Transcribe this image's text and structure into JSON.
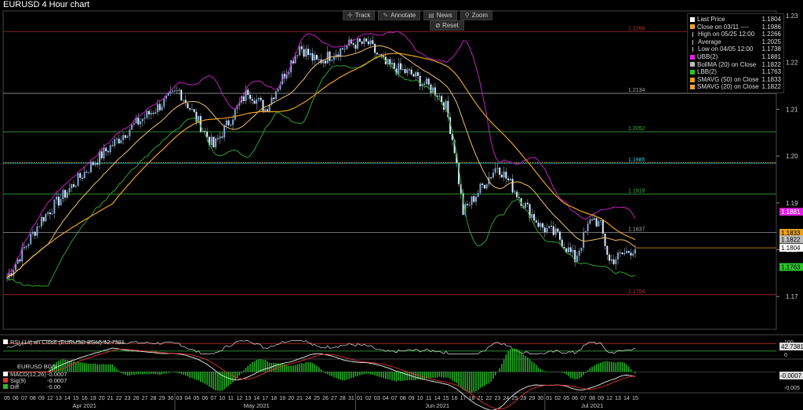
{
  "title": "EURUSD 4 Hour chart",
  "toolbar": {
    "track_label": "Track",
    "annotate_label": "Annotate",
    "news_label": "News",
    "zoom_label": "Zoom",
    "reset_label": "Reset"
  },
  "legend": [
    {
      "label": "Last Price",
      "value": "1.1804",
      "color": "#ffffff",
      "icon": "square"
    },
    {
      "label": "Close on 03/11 ----",
      "value": "1.1986",
      "color": "#f0a030",
      "icon": "square"
    },
    {
      "label": "High on 05/25 12:00",
      "value": "1.2266",
      "color": "#cccccc",
      "icon": "high-marker"
    },
    {
      "label": "Average",
      "value": "1.2025",
      "color": "#cccccc",
      "icon": "average-marker"
    },
    {
      "label": "Low on 04/05 12:00",
      "value": "1.1738",
      "color": "#cccccc",
      "icon": "low-marker"
    },
    {
      "label": "UBB(2)",
      "value": "1.1881",
      "color": "#e020e0",
      "icon": "square"
    },
    {
      "label": "BollMA (20)  on Close",
      "value": "1.1822",
      "color": "#bbbbbb",
      "icon": "square"
    },
    {
      "label": "LBB(2)",
      "value": "1.1763",
      "color": "#30c030",
      "icon": "square"
    },
    {
      "label": "SMAVG (50)  on Close",
      "value": "1.1833",
      "color": "#e8a020",
      "icon": "square"
    },
    {
      "label": "SMAVG (20)  on Close",
      "value": "1.1822",
      "color": "#f0a040",
      "icon": "square"
    }
  ],
  "chart_data": {
    "type": "line",
    "symbol": "EURUSD",
    "timeframe": "4 Hour",
    "ylim": [
      1.163,
      1.231
    ],
    "y_ticks": [
      "1.23",
      "1.22",
      "1.21",
      "1.20",
      "1.19",
      "1.18",
      "1.17"
    ],
    "y_tick_values": [
      1.23,
      1.22,
      1.21,
      1.2,
      1.19,
      1.18,
      1.17
    ],
    "x_day_labels": [
      "05",
      "06",
      "07",
      "08",
      "09",
      "12",
      "13",
      "14",
      "15",
      "16",
      "19",
      "20",
      "21",
      "22",
      "23",
      "26",
      "27",
      "28",
      "29",
      "30",
      "03",
      "04",
      "05",
      "06",
      "07",
      "10",
      "11",
      "12",
      "13",
      "14",
      "17",
      "18",
      "19",
      "20",
      "21",
      "24",
      "25",
      "26",
      "27",
      "28",
      "31",
      "01",
      "02",
      "03",
      "04",
      "07",
      "08",
      "09",
      "10",
      "11",
      "14",
      "15",
      "16",
      "17",
      "18",
      "21",
      "22",
      "23",
      "24",
      "25",
      "28",
      "29",
      "30",
      "01",
      "02",
      "05",
      "06",
      "07",
      "08",
      "09",
      "12",
      "13",
      "14",
      "15"
    ],
    "x_month_labels": [
      "Apr 2021",
      "May 2021",
      "Jun 2021",
      "Jul 2021"
    ],
    "horizontal_levels": [
      {
        "label": "1.2266",
        "value": 1.2266,
        "color": "#c03030"
      },
      {
        "label": "1.2134",
        "value": 1.2134,
        "color": "#aaaaaa"
      },
      {
        "label": "1.2052",
        "value": 1.2052,
        "color": "#40b040"
      },
      {
        "label": "1.1985",
        "value": 1.1985,
        "color": "#40d0d0"
      },
      {
        "label": "1.1919",
        "value": 1.1919,
        "color": "#40b040"
      },
      {
        "label": "1.1837",
        "value": 1.1837,
        "color": "#aaaaaa"
      },
      {
        "label": "1.1704",
        "value": 1.1704,
        "color": "#c03030"
      }
    ],
    "close_reference": {
      "value": 1.1986,
      "color": "#f0a030"
    },
    "last_price_line": {
      "value": 1.1804,
      "color": "#e0a030"
    },
    "price_tags": [
      {
        "label": "1.1881",
        "value": 1.1881,
        "bg": "#e020e0",
        "fg": "#ffffff"
      },
      {
        "label": "1.1833",
        "value": 1.1836,
        "bg": "#e8a020",
        "fg": "#000000"
      },
      {
        "label": "1.1822",
        "value": 1.1822,
        "bg": "#bbbbbb",
        "fg": "#000000"
      },
      {
        "label": "1.1804",
        "value": 1.1804,
        "bg": "#ffffff",
        "fg": "#000000"
      },
      {
        "label": "1.1763",
        "value": 1.1763,
        "bg": "#30c030",
        "fg": "#000000"
      }
    ],
    "price_anchors": {
      "x": [
        0,
        4,
        10,
        14,
        20,
        24,
        28,
        30,
        34,
        36,
        40,
        42,
        44,
        47,
        50,
        51,
        52,
        53,
        55,
        57,
        60,
        62,
        64,
        66,
        68,
        69,
        70,
        73
      ],
      "close": [
        1.174,
        1.1865,
        1.1985,
        1.2055,
        1.214,
        1.202,
        1.214,
        1.21,
        1.2235,
        1.22,
        1.224,
        1.224,
        1.2195,
        1.2175,
        1.2135,
        1.2105,
        1.2015,
        1.188,
        1.193,
        1.198,
        1.19,
        1.185,
        1.183,
        1.178,
        1.187,
        1.185,
        1.1775,
        1.1804
      ]
    },
    "rsi": {
      "label": "RSI (14)  on Close (EURUSD BGN)",
      "value": "42.7381",
      "ylim": [
        0,
        100
      ],
      "ticks": [
        "100",
        "0"
      ],
      "upper": 70,
      "lower": 30
    },
    "macd": {
      "label": "EURUSD BGN",
      "macd_label": "MACD(12,26)",
      "macd_value": "-0.0007",
      "sig_label": "Sig(9)",
      "sig_value": "-0.0007",
      "diff_label": "Diff",
      "diff_value": "-0.00",
      "tag": "-0.0007",
      "ticks": [
        "-0.005"
      ],
      "ylim": [
        -0.006,
        0.003
      ]
    }
  }
}
